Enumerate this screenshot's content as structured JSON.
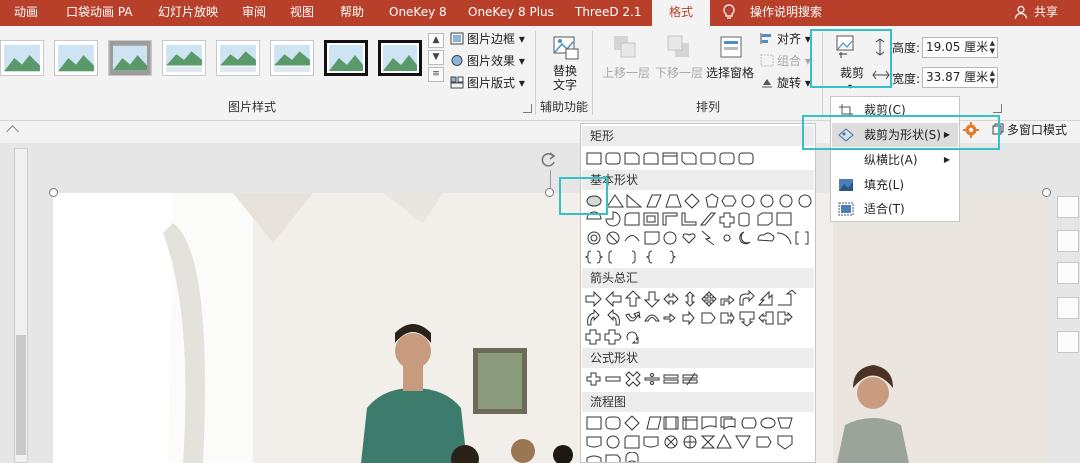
{
  "tabs": [
    "动画",
    "口袋动画 PA",
    "幻灯片放映",
    "审阅",
    "视图",
    "帮助",
    "OneKey 8",
    "OneKey 8 Plus",
    "ThreeD 2.1",
    "格式",
    "操作说明搜索"
  ],
  "active_tab": "格式",
  "share_label": "共享",
  "ribbon": {
    "picture_styles": {
      "border_label": "图片边框",
      "effects_label": "图片效果",
      "layout_label": "图片版式",
      "group_label": "图片样式"
    },
    "accessibility": {
      "alt_text_label_line1": "替换",
      "alt_text_label_line2": "文字",
      "group_label": "辅助功能"
    },
    "arrange": {
      "bring_forward_label": "上移一层",
      "send_backward_label": "下移一层",
      "selection_pane_label": "选择窗格",
      "align_label": "对齐",
      "group_label_cmd": "组合",
      "rotate_label": "旋转",
      "group_label": "排列"
    },
    "size": {
      "crop_label": "裁剪",
      "height_label": "高度:",
      "height_value": "19.05 厘米",
      "width_label": "宽度:",
      "width_value": "33.87 厘米"
    }
  },
  "crop_menu": {
    "items": [
      "裁剪(C)",
      "裁剪为形状(S)",
      "纵横比(A)",
      "填充(L)",
      "适合(T)"
    ]
  },
  "multi_window_label": "多窗口模式",
  "shapes_menu": {
    "sections": [
      "矩形",
      "基本形状",
      "箭头总汇",
      "公式形状",
      "流程图"
    ]
  },
  "colors": {
    "accent": "#b8402a",
    "highlight": "#35c0c5"
  }
}
